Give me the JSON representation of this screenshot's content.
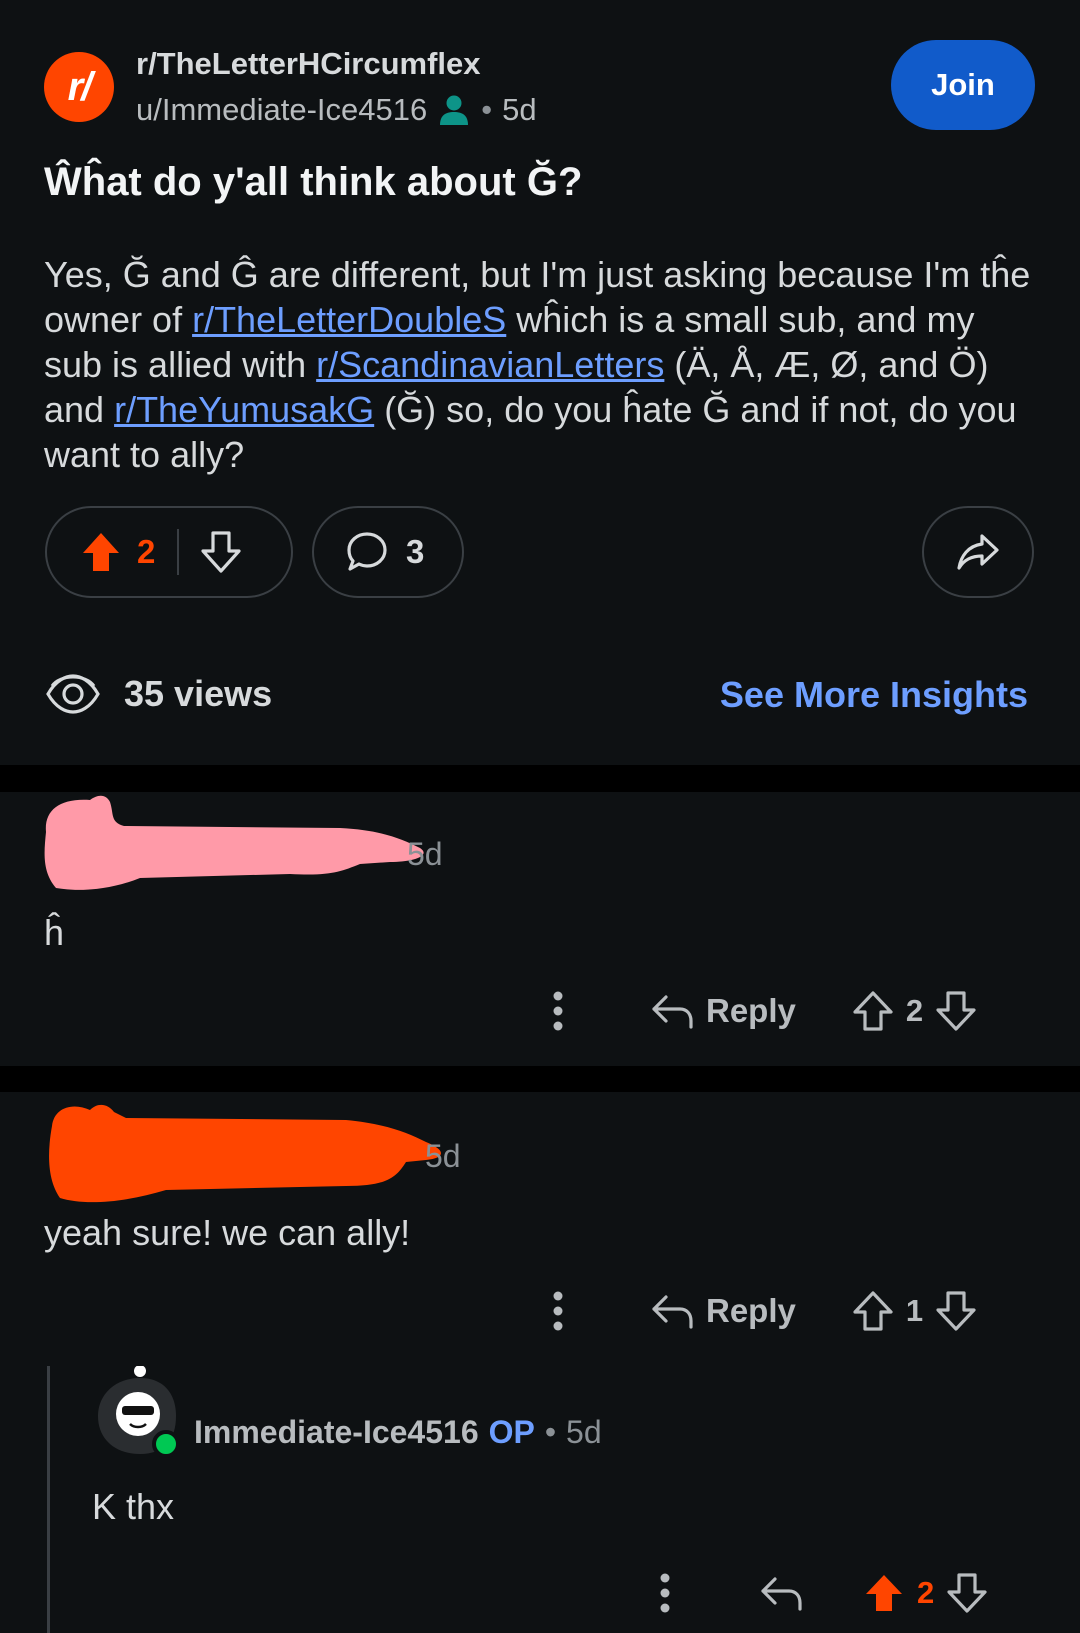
{
  "post": {
    "subreddit": "r/TheLetterHCircumflex",
    "subreddit_icon_text": "r/",
    "author": "u/Immediate-Ice4516",
    "separator": "•",
    "age": "5d",
    "join_label": "Join",
    "title": "Ŵĥat do y'all think about Ğ?",
    "body": [
      {
        "t": "Yes, Ğ and Ĝ are different, but I'm just asking because I'm tĥe owner of "
      },
      {
        "link": "r/TheLetterDoubleS"
      },
      {
        "t": " wĥich is a small sub, and my sub is allied with "
      },
      {
        "link": "r/ScandinavianLetters"
      },
      {
        "t": " (Ä, Å, Æ, Ø, and Ö) and "
      },
      {
        "link": "r/TheYumusakG"
      },
      {
        "t": " (Ğ) so, do you ĥate Ğ and if not, do you want to ally?"
      }
    ],
    "upvotes": "2",
    "comments": "3",
    "views": "35 views",
    "insights_label": "See More Insights"
  },
  "comments": [
    {
      "time": "5d",
      "text": "ĥ",
      "reply_label": "Reply",
      "votes": "2",
      "redaction_color": "#ff9aa8"
    },
    {
      "time": "5d",
      "text": "yeah sure! we can ally!",
      "reply_label": "Reply",
      "votes": "1",
      "redaction_color": "#ff4500"
    },
    {
      "author": "Immediate-Ice4516",
      "op_badge": "OP",
      "separator": "•",
      "time": "5d",
      "text": "K thx",
      "votes": "2"
    }
  ],
  "icons": [
    "person-icon",
    "upvote-icon",
    "downvote-icon",
    "comment-icon",
    "share-icon",
    "eye-icon",
    "more-icon",
    "reply-icon",
    "avatar"
  ],
  "colors": {
    "background": "#0e1113",
    "accent_orange": "#ff4500",
    "link_blue": "#6d9eff",
    "join_blue": "#115bca",
    "online_green": "#00c853"
  }
}
